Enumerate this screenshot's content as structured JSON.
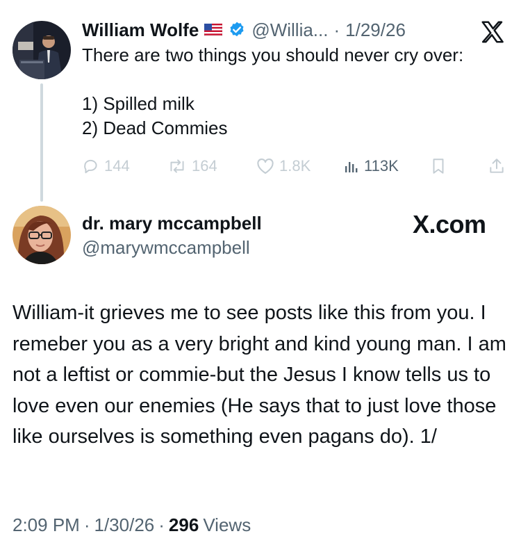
{
  "tweet1": {
    "display_name": "William Wolfe",
    "flag_emoji": "🇺🇸",
    "handle_truncated": "@Willia...",
    "separator": "·",
    "date": "1/29/26",
    "line1": "There are two things you should never cry over:",
    "line2": "1) Spilled milk",
    "line3": "2) Dead Commies",
    "replies": "144",
    "reposts": "164",
    "likes": "1.8K",
    "views": "113K",
    "brand_icon": "x-logo-icon",
    "verified_color": "#1d9bf0"
  },
  "tweet2": {
    "display_name": "dr. mary mccampbell",
    "handle": "@marywmccampbell",
    "watermark": "X.com",
    "body": "William-it grieves me to see posts like this from you. I remeber you as a very bright and kind young man. I am not a leftist or commie-but the Jesus I know tells us to love even our enemies (He says that to just love those like ourselves is something even pagans do). 1/",
    "time": "2:09 PM",
    "separator1": "·",
    "date": "1/30/26",
    "separator2": "·",
    "views_count": "296",
    "views_label": "Views"
  },
  "colors": {
    "text": "#0f1419",
    "muted": "#536471",
    "faded_icons": "#c4cdd3",
    "thread_line": "#cfd9de",
    "verified": "#1d9bf0"
  }
}
